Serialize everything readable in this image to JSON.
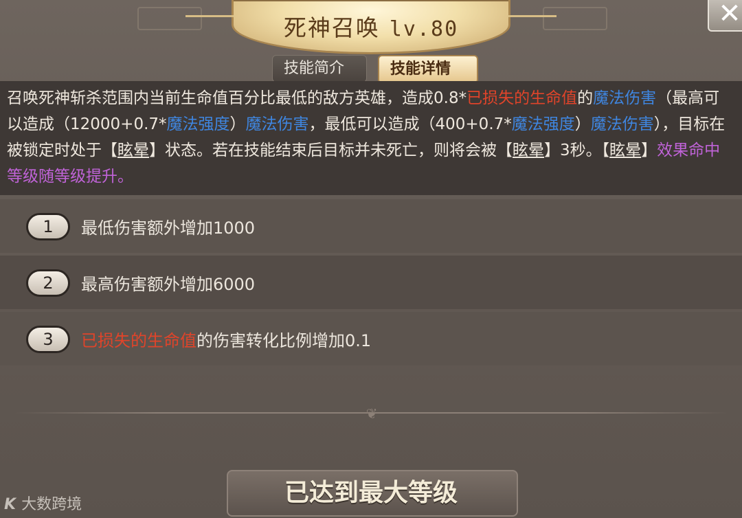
{
  "header": {
    "title": "死神召唤",
    "level": "lv.80",
    "close_icon": "close-icon"
  },
  "tabs": [
    {
      "label": "技能简介",
      "active": false
    },
    {
      "label": "技能详情",
      "active": true
    }
  ],
  "description": {
    "s1": "召唤死神斩杀范围内当前生命值百分比最低的敌方英雄，造成0.8*",
    "s2": "已损失的生命值",
    "s3": "的",
    "s4": "魔法伤害",
    "s5": "（最高可以造成（12000+0.7*",
    "s6": "魔法强度",
    "s7": "）",
    "s8": "魔法伤害",
    "s9": "，最低可以造成（400+0.7*",
    "s10": "魔法强度",
    "s11": "）",
    "s12": "魔法伤害",
    "s13": "），目标在被锁定时处于【",
    "s14": "眩晕",
    "s15": "】状态。若在技能结束后目标并未死亡，则将会被【",
    "s16": "眩晕",
    "s17": "】3秒。【",
    "s18": "眩晕",
    "s19": "】",
    "s20": "效果命中等级随等级提升。"
  },
  "upgrades": [
    {
      "num": "1",
      "text": "最低伤害额外增加1000"
    },
    {
      "num": "2",
      "text": "最高伤害额外增加6000"
    },
    {
      "num": "3",
      "highlight": "已损失的生命值",
      "text": "的伤害转化比例增加0.1"
    }
  ],
  "footer": {
    "max_button": "已达到最大等级"
  },
  "watermark": {
    "logo": "K",
    "text": "大数跨境"
  },
  "colors": {
    "red": "#e0442a",
    "blue": "#3f86e0",
    "purple": "#c063d8"
  }
}
